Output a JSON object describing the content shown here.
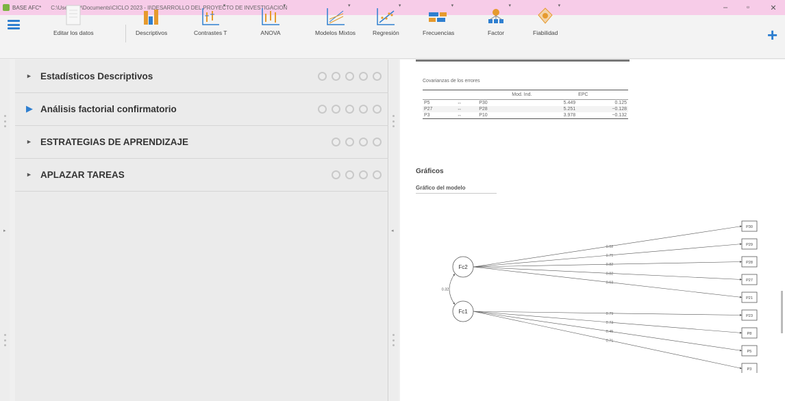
{
  "window": {
    "app_name": "BASE AFC*",
    "path": "C:\\Users\\HP\\Documents\\CICLO 2023 - II\\DESARROLLO DEL PROYECTO DE INVESTIGACION",
    "minimize": "–",
    "maximize": "▫",
    "close": "✕"
  },
  "toolbar": {
    "plus_label": "+",
    "items": [
      {
        "label": "Editar los datos",
        "icon": "edit-data-icon"
      },
      {
        "label": "Descriptivos",
        "icon": "bar-chart-icon"
      },
      {
        "label": "Contrastes T",
        "icon": "t-test-icon"
      },
      {
        "label": "ANOVA",
        "icon": "anova-icon"
      },
      {
        "label": "Modelos Mixtos",
        "icon": "mixed-models-icon"
      },
      {
        "label": "Regresión",
        "icon": "regression-icon"
      },
      {
        "label": "Frecuencias",
        "icon": "frequencies-icon"
      },
      {
        "label": "Factor",
        "icon": "factor-icon"
      },
      {
        "label": "Fiabilidad",
        "icon": "reliability-icon"
      }
    ]
  },
  "analyses": [
    {
      "title": "Estadísticos Descriptivos",
      "dots": 5,
      "expanded": false
    },
    {
      "title": "Análisis factorial confirmatorio",
      "dots": 5,
      "expanded": true
    },
    {
      "title": "ESTRATEGIAS DE APRENDIZAJE",
      "dots": 4,
      "expanded": false
    },
    {
      "title": "APLAZAR TAREAS",
      "dots": 4,
      "expanded": false
    }
  ],
  "results": {
    "cov_caption": "Covarianzas de los errores",
    "cov_headers": [
      "",
      "",
      "",
      "Mod. Ind.",
      "EPC"
    ],
    "cov_rows": [
      [
        "P5",
        "↔",
        "P30",
        "5.449",
        "0.125"
      ],
      [
        "P27",
        "↔",
        "P28",
        "5.251",
        "−0.128"
      ],
      [
        "P3",
        "↔",
        "P10",
        "3.978",
        "−0.132"
      ]
    ],
    "graphs_heading": "Gráficos",
    "model_graph_heading": "Gráfico del modelo"
  },
  "model": {
    "factors": [
      "Fc2",
      "Fc1"
    ],
    "covariance": "0.32",
    "fc2_loadings": [
      "0.62",
      "0.71",
      "0.82",
      "0.82",
      "0.63"
    ],
    "fc1_loadings": [
      "0.79",
      "0.73",
      "0.45",
      "0.71"
    ],
    "items": [
      "P30",
      "P29",
      "P28",
      "P27",
      "P21",
      "P23",
      "P8",
      "P5",
      "P3"
    ]
  },
  "colors": {
    "titlebar": "#f7cce8",
    "accent": "#2f7fd0",
    "icon_orange": "#e69a2e",
    "icon_blue": "#2f7fd0"
  }
}
